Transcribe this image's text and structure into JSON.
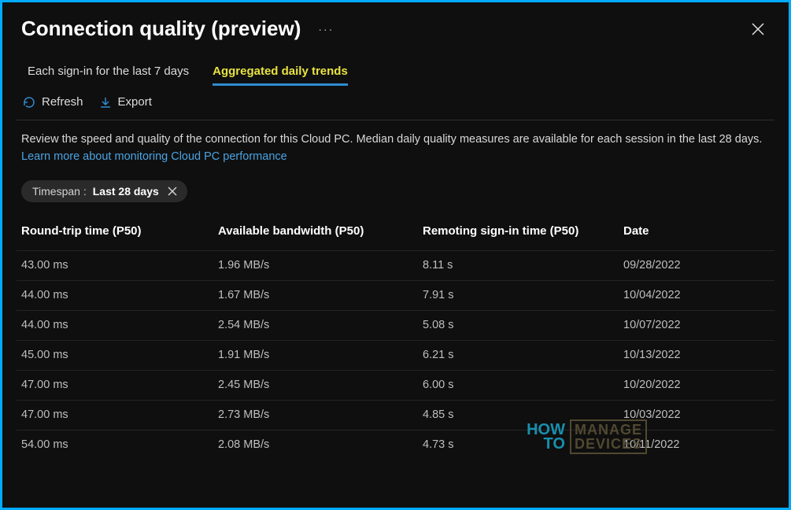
{
  "header": {
    "title": "Connection quality (preview)"
  },
  "tabs": [
    {
      "label": "Each sign-in for the last 7 days",
      "active": false
    },
    {
      "label": "Aggregated daily trends",
      "active": true
    }
  ],
  "toolbar": {
    "refresh_label": "Refresh",
    "export_label": "Export"
  },
  "description": {
    "text": "Review the speed and quality of the connection for this Cloud PC. Median daily quality measures are available for each session in the last 28 days. ",
    "link_text": "Learn more about monitoring Cloud PC performance"
  },
  "filter": {
    "label": "Timespan : ",
    "value": "Last 28 days"
  },
  "table": {
    "columns": [
      "Round-trip time (P50)",
      "Available bandwidth (P50)",
      "Remoting sign-in time (P50)",
      "Date"
    ],
    "rows": [
      {
        "rtt": "43.00 ms",
        "bw": "1.96 MB/s",
        "signin": "8.11 s",
        "date": "09/28/2022"
      },
      {
        "rtt": "44.00 ms",
        "bw": "1.67 MB/s",
        "signin": "7.91 s",
        "date": "10/04/2022"
      },
      {
        "rtt": "44.00 ms",
        "bw": "2.54 MB/s",
        "signin": "5.08 s",
        "date": "10/07/2022"
      },
      {
        "rtt": "45.00 ms",
        "bw": "1.91 MB/s",
        "signin": "6.21 s",
        "date": "10/13/2022"
      },
      {
        "rtt": "47.00 ms",
        "bw": "2.45 MB/s",
        "signin": "6.00 s",
        "date": "10/20/2022"
      },
      {
        "rtt": "47.00 ms",
        "bw": "2.73 MB/s",
        "signin": "4.85 s",
        "date": "10/03/2022"
      },
      {
        "rtt": "54.00 ms",
        "bw": "2.08 MB/s",
        "signin": "4.73 s",
        "date": "10/11/2022"
      }
    ]
  },
  "watermark": {
    "line1": "HOW",
    "line2": "TO",
    "box1": "MANAGE",
    "box2": "DEVICES"
  }
}
